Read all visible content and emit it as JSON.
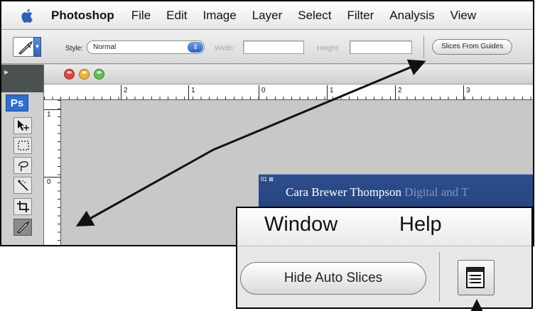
{
  "menubar": {
    "app_name": "Photoshop",
    "items": [
      "File",
      "Edit",
      "Image",
      "Layer",
      "Select",
      "Filter",
      "Analysis",
      "View"
    ]
  },
  "options_bar": {
    "style_label": "Style:",
    "style_value": "Normal",
    "width_label": "Width:",
    "height_label": "Height:",
    "slices_from_guides": "Slices From Guides"
  },
  "tools_panel": {
    "logo": "Ps"
  },
  "document": {
    "ruler_h": [
      "2",
      "1",
      "0",
      "1",
      "2",
      "3"
    ],
    "ruler_v": [
      "1",
      "0"
    ],
    "slice_badge": "01",
    "slice_name": "Cara Brewer Thompson",
    "slice_tagline": "Digital and T"
  },
  "zoom_callout": {
    "menu_items": [
      "Window",
      "Help"
    ],
    "hide_auto_slices": "Hide Auto Slices"
  },
  "colors": {
    "accent_blue": "#2c62c0",
    "ps_logo": "#2b6fd0",
    "slice_bg": "#2d4d8a",
    "close_light": "#e2433b",
    "minimize_light": "#f1b13a",
    "zoom_light": "#5cc251"
  },
  "icons": [
    "apple-icon",
    "slice-tool-icon",
    "move-tool-icon",
    "marquee-tool-icon",
    "lasso-tool-icon",
    "magic-wand-icon",
    "crop-tool-icon",
    "slice-options-icon"
  ]
}
